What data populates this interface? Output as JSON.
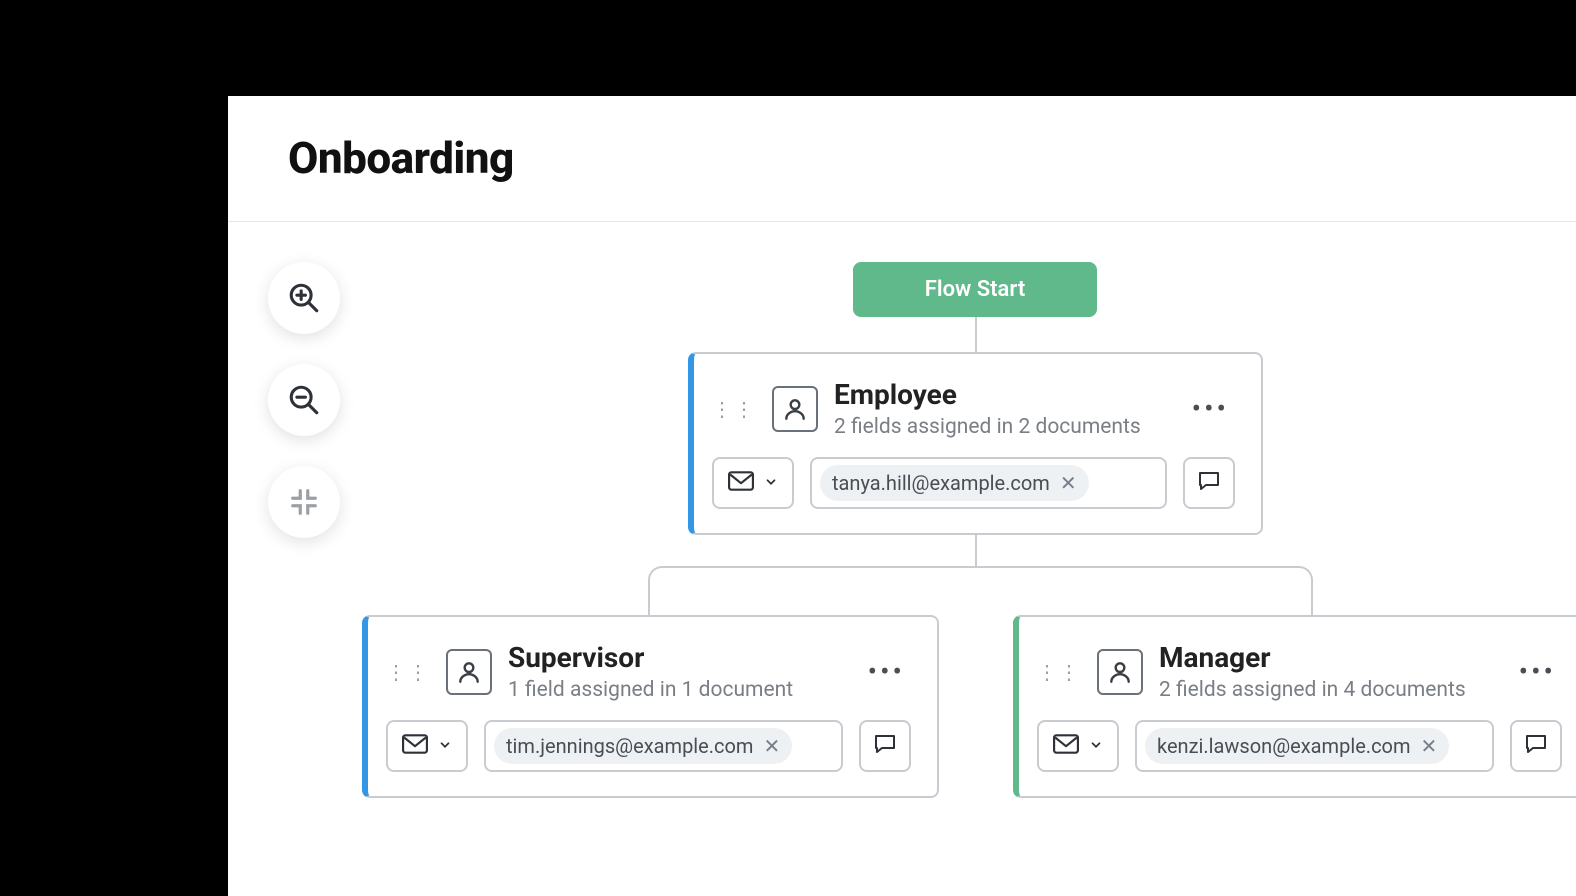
{
  "page": {
    "title": "Onboarding",
    "flow_start_label": "Flow Start"
  },
  "nodes": [
    {
      "key": "employee",
      "accent": "blue",
      "title": "Employee",
      "subtitle": "2 fields assigned in 2 documents",
      "email": "tanya.hill@example.com"
    },
    {
      "key": "supervisor",
      "accent": "blue",
      "title": "Supervisor",
      "subtitle": "1 field assigned in 1 document",
      "email": "tim.jennings@example.com"
    },
    {
      "key": "manager",
      "accent": "green",
      "title": "Manager",
      "subtitle": "2 fields assigned in 4 documents",
      "email": "kenzi.lawson@example.com"
    }
  ]
}
